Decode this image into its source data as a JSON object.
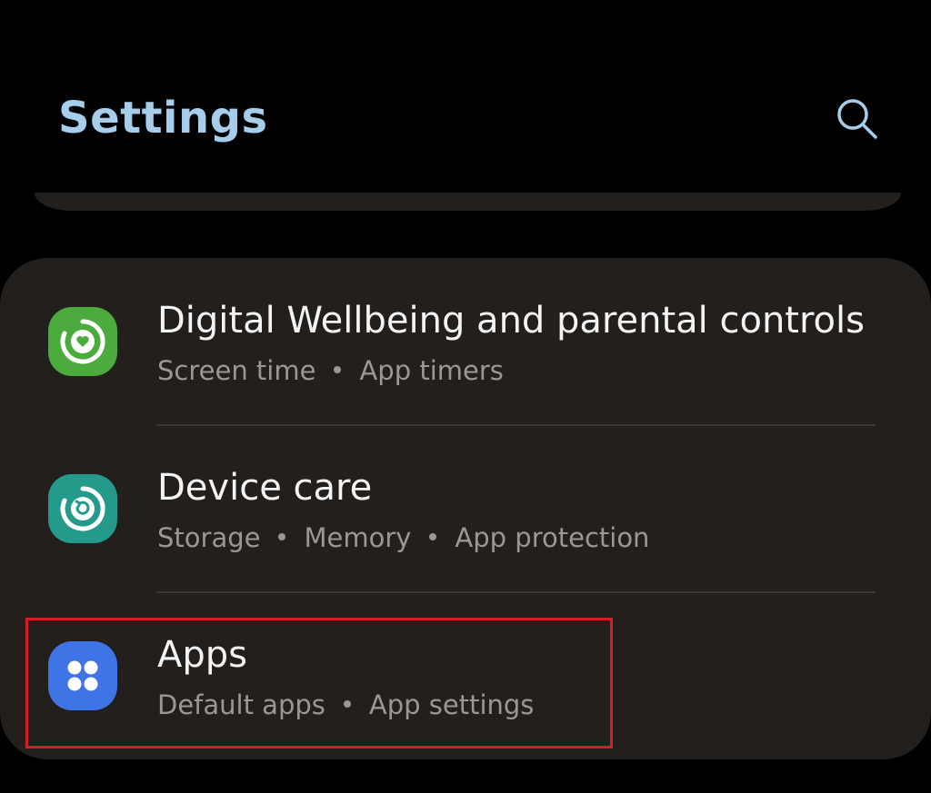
{
  "header": {
    "title": "Settings",
    "search_icon": "search-icon"
  },
  "list": {
    "items": [
      {
        "id": "digital-wellbeing",
        "title": "Digital Wellbeing and parental controls",
        "subtitle_parts": [
          "Screen time",
          "App timers"
        ],
        "icon": "digital-wellbeing-icon",
        "icon_color": "#4bab3c"
      },
      {
        "id": "device-care",
        "title": "Device care",
        "subtitle_parts": [
          "Storage",
          "Memory",
          "App protection"
        ],
        "icon": "device-care-icon",
        "icon_color": "#249a8a"
      },
      {
        "id": "apps",
        "title": "Apps",
        "subtitle_parts": [
          "Default apps",
          "App settings"
        ],
        "icon": "apps-icon",
        "icon_color": "#3f74e6",
        "highlighted": true
      }
    ]
  },
  "colors": {
    "background": "#000000",
    "card": "#221f1c",
    "title_accent": "#a6cdea",
    "highlight": "#d31f26"
  }
}
